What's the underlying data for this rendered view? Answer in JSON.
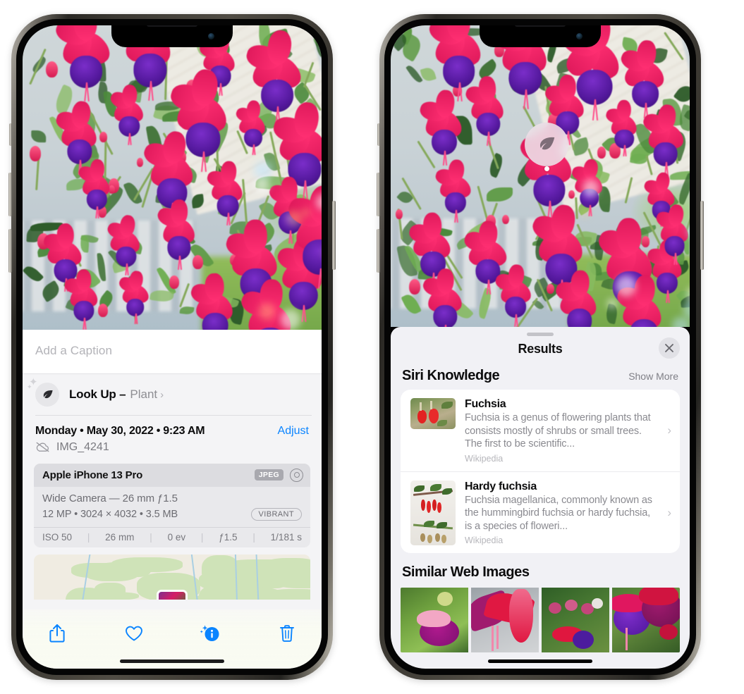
{
  "meta": {
    "scene": "iOS Photos app Visual Look Up — two iPhone 13 Pro screenshots side by side",
    "accent_blue": "#0a84ff",
    "sheet_bg": "#f1f1f5",
    "toolbar_bg": "#f9fbf2"
  },
  "left_phone": {
    "name": "photo-info-screen",
    "caption": {
      "value": "",
      "placeholder": "Add a Caption"
    },
    "lookup_row": {
      "icon": "leaf-icon",
      "sparkle": "sparkle-icon",
      "title": "Look Up –",
      "subject": "Plant",
      "chevron": "chevron-right-icon"
    },
    "date_row": {
      "date": "Monday • May 30, 2022 • 9:23 AM",
      "adjust_label": "Adjust"
    },
    "file_row": {
      "icon": "icloud-slash-icon",
      "filename": "IMG_4241"
    },
    "camera_card": {
      "model": "Apple iPhone 13 Pro",
      "format_tag": "JPEG",
      "raw_icon": "raw-circles-icon",
      "lens_line": "Wide Camera — 26 mm ƒ1.5",
      "size_line": "12 MP • 3024 × 4032 • 3.5 MB",
      "style_tag": "VIBRANT",
      "exif": [
        "ISO 50",
        "26 mm",
        "0 ev",
        "ƒ1.5",
        "1/181 s"
      ]
    },
    "map": {
      "name": "location-map-thumbnail"
    },
    "toolbar": [
      {
        "name": "share-button",
        "icon": "share-icon"
      },
      {
        "name": "favorite-button",
        "icon": "heart-icon"
      },
      {
        "name": "info-button",
        "icon": "info-sparkle-icon"
      },
      {
        "name": "delete-button",
        "icon": "trash-icon"
      }
    ]
  },
  "right_phone": {
    "name": "visual-look-up-results-screen",
    "photo_badge": {
      "icon": "leaf-icon",
      "name": "visual-look-up-badge"
    },
    "sheet": {
      "grabber": "drag-handle",
      "title": "Results",
      "close_icon": "close-icon"
    },
    "siri_knowledge": {
      "section_title": "Siri Knowledge",
      "action_label": "Show More",
      "cards": [
        {
          "title": "Fuchsia",
          "description": "Fuchsia is a genus of flowering plants that consists mostly of shrubs or small trees. The first to be scientific...",
          "source": "Wikipedia",
          "thumb": "fuchsia-red-bells-thumbnail",
          "chevron": "chevron-right-icon"
        },
        {
          "title": "Hardy fuchsia",
          "description": "Fuchsia magellanica, commonly known as the hummingbird fuchsia or hardy fuchsia, is a species of floweri...",
          "source": "Wikipedia",
          "thumb": "hardy-fuchsia-specimen-thumbnail",
          "chevron": "chevron-right-icon"
        }
      ]
    },
    "similar_web_images": {
      "section_title": "Similar Web Images",
      "tiles": [
        {
          "name": "web-image-1",
          "alt": "pink and magenta fuchsia with green leaves"
        },
        {
          "name": "web-image-2",
          "alt": "crimson fuchsia blossoms close up"
        },
        {
          "name": "web-image-3",
          "alt": "fuchsia shrub with many buds"
        },
        {
          "name": "web-image-4",
          "alt": "purple and red double fuchsia"
        }
      ]
    }
  }
}
